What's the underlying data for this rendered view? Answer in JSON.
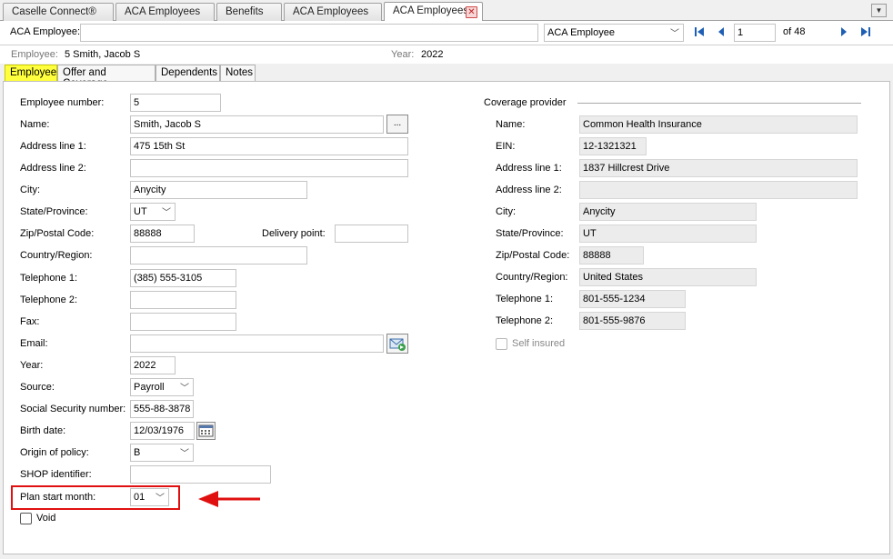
{
  "tabs": [
    {
      "label": "Caselle Connect®"
    },
    {
      "label": "ACA Employees"
    },
    {
      "label": "Benefits"
    },
    {
      "label": "ACA Employees"
    },
    {
      "label": "ACA Employees"
    }
  ],
  "header": {
    "aca_employee_label": "ACA Employee:",
    "aca_employee_value": "",
    "view_select": "ACA Employee",
    "record_number": "1",
    "record_total": "of 48"
  },
  "info": {
    "employee_label": "Employee:",
    "employee_value": "5  Smith, Jacob S",
    "year_label": "Year:",
    "year_value": "2022"
  },
  "subtabs": [
    "Employee",
    "Offer and Coverage",
    "Dependents",
    "Notes"
  ],
  "employee": {
    "number_label": "Employee number:",
    "number": "5",
    "name_label": "Name:",
    "name": "Smith, Jacob S",
    "addr1_label": "Address line 1:",
    "addr1": "475 15th St",
    "addr2_label": "Address line 2:",
    "addr2": "",
    "city_label": "City:",
    "city": "Anycity",
    "state_label": "State/Province:",
    "state": "UT",
    "zip_label": "Zip/Postal Code:",
    "zip": "88888",
    "delivery_label": "Delivery point:",
    "delivery": "",
    "country_label": "Country/Region:",
    "country": "",
    "tel1_label": "Telephone 1:",
    "tel1": "(385) 555-3105",
    "tel2_label": "Telephone 2:",
    "tel2": "",
    "fax_label": "Fax:",
    "fax": "",
    "email_label": "Email:",
    "email": "",
    "year_label": "Year:",
    "year": "2022",
    "source_label": "Source:",
    "source": "Payroll",
    "ssn_label": "Social Security number:",
    "ssn": "555-88-3878",
    "birth_label": "Birth date:",
    "birth": "12/03/1976",
    "origin_label": "Origin of policy:",
    "origin": "B",
    "shop_label": "SHOP identifier:",
    "shop": "",
    "plan_label": "Plan start month:",
    "plan": "01",
    "void_label": "Void"
  },
  "provider": {
    "section_label": "Coverage provider",
    "name_label": "Name:",
    "name": "Common Health Insurance",
    "ein_label": "EIN:",
    "ein": "12-1321321",
    "addr1_label": "Address line 1:",
    "addr1": "1837 Hillcrest Drive",
    "addr2_label": "Address line 2:",
    "addr2": "",
    "city_label": "City:",
    "city": "Anycity",
    "state_label": "State/Province:",
    "state": "UT",
    "zip_label": "Zip/Postal Code:",
    "zip": "88888",
    "country_label": "Country/Region:",
    "country": "United States",
    "tel1_label": "Telephone 1:",
    "tel1": "801-555-1234",
    "tel2_label": "Telephone 2:",
    "tel2": "801-555-9876",
    "self_insured_label": "Self insured"
  },
  "colors": {
    "active_subtab": "#ffff3d",
    "highlight": "#e01010",
    "nav_icons": "#1e5fb4"
  }
}
